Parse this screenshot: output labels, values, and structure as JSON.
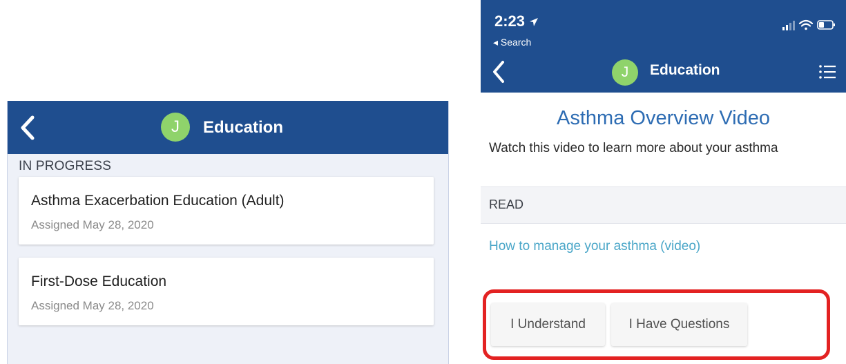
{
  "left": {
    "header": {
      "avatar_initial": "J",
      "title": "Education"
    },
    "section_label": "IN PROGRESS",
    "items": [
      {
        "title": "Asthma Exacerbation Education (Adult)",
        "subtitle": "Assigned May 28, 2020"
      },
      {
        "title": "First-Dose Education",
        "subtitle": "Assigned May 28, 2020"
      }
    ]
  },
  "right": {
    "status_bar": {
      "time": "2:23",
      "back_app": "◂ Search"
    },
    "header": {
      "avatar_initial": "J",
      "title": "Education"
    },
    "content": {
      "title": "Asthma Overview Video",
      "description": "Watch this video to learn more about your asthma",
      "read_label": "READ",
      "link_text": "How to manage your asthma (video)"
    },
    "buttons": {
      "understand": "I Understand",
      "questions": "I Have Questions"
    }
  },
  "colors": {
    "header_blue": "#1f4e8f",
    "avatar_green": "#8fd36b",
    "title_blue": "#2d6cb3",
    "link_blue": "#4aa6c8",
    "highlight_red": "#e32222"
  }
}
